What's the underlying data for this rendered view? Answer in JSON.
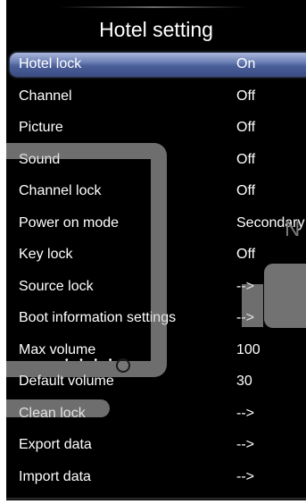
{
  "header": {
    "title": "Hotel setting"
  },
  "menu": {
    "items": [
      {
        "label": "Hotel lock",
        "value": "On"
      },
      {
        "label": "Channel",
        "value": "Off"
      },
      {
        "label": "Picture",
        "value": "Off"
      },
      {
        "label": "Sound",
        "value": "Off"
      },
      {
        "label": "Channel lock",
        "value": "Off"
      },
      {
        "label": "Power on mode",
        "value": "Secondary"
      },
      {
        "label": "Key lock",
        "value": "Off"
      },
      {
        "label": "Source lock",
        "value": "-->"
      },
      {
        "label": "Boot information settings",
        "value": "-->"
      },
      {
        "label": "Max volume",
        "value": "100"
      },
      {
        "label": "Default volume",
        "value": "30"
      },
      {
        "label": "Clean lock",
        "value": "-->"
      },
      {
        "label": "Export data",
        "value": "-->"
      },
      {
        "label": "Import data",
        "value": "-->"
      }
    ]
  },
  "overlay": {
    "partial_text": "N",
    "dots": "• • • •"
  },
  "colors": {
    "background": "#000000",
    "text": "#ffffff",
    "highlight": "#4a5e98"
  }
}
